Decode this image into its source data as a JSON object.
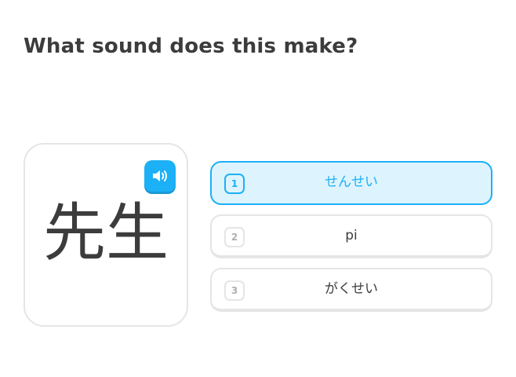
{
  "question": "What sound does this make?",
  "character": {
    "text": "先生",
    "audio_icon": "speaker-icon"
  },
  "options": [
    {
      "number": "1",
      "label": "せんせい",
      "selected": true
    },
    {
      "number": "2",
      "label": "pi",
      "selected": false
    },
    {
      "number": "3",
      "label": "がくせい",
      "selected": false
    }
  ],
  "colors": {
    "accent": "#1cb0f6",
    "selected_bg": "#ddf4ff",
    "border": "#e5e5e5",
    "text": "#3c3c3c",
    "muted": "#afafaf"
  }
}
